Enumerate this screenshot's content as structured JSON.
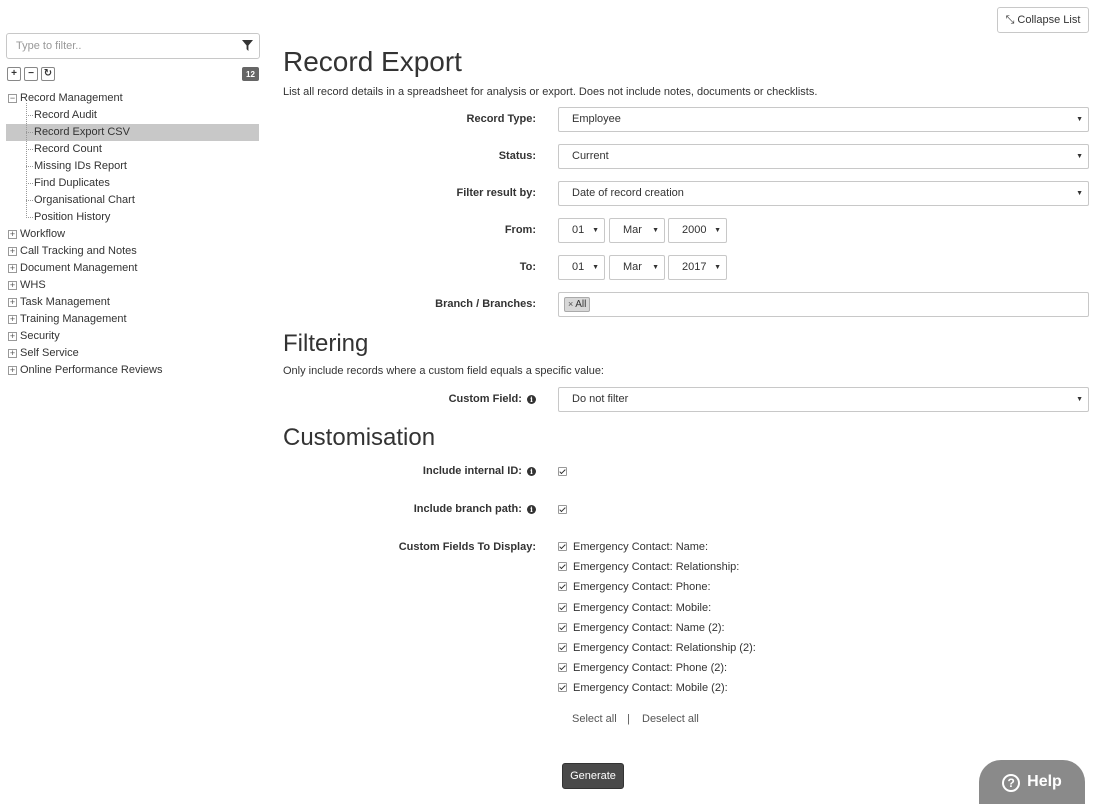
{
  "header": {
    "collapse_label": "Collapse List"
  },
  "sidebar": {
    "filter_placeholder": "Type to filter..",
    "tools": {
      "expand": "+",
      "collapse": "−",
      "refresh": "↻"
    },
    "count": "12",
    "tree": [
      {
        "label": "Record Management",
        "expanded": true,
        "children": [
          {
            "label": "Record Audit"
          },
          {
            "label": "Record Export CSV",
            "selected": true
          },
          {
            "label": "Record Count"
          },
          {
            "label": "Missing IDs Report"
          },
          {
            "label": "Find Duplicates"
          },
          {
            "label": "Organisational Chart"
          },
          {
            "label": "Position History"
          }
        ]
      },
      {
        "label": "Workflow"
      },
      {
        "label": "Call Tracking and Notes"
      },
      {
        "label": "Document Management"
      },
      {
        "label": "WHS"
      },
      {
        "label": "Task Management"
      },
      {
        "label": "Training Management"
      },
      {
        "label": "Security"
      },
      {
        "label": "Self Service"
      },
      {
        "label": "Online Performance Reviews"
      }
    ]
  },
  "main": {
    "title": "Record Export",
    "description": "List all record details in a spreadsheet for analysis or export. Does not include notes, documents or checklists.",
    "fields": {
      "record_type": {
        "label": "Record Type:",
        "value": "Employee"
      },
      "status": {
        "label": "Status:",
        "value": "Current"
      },
      "filter_by": {
        "label": "Filter result by:",
        "value": "Date of record creation"
      },
      "from": {
        "label": "From:",
        "day": "01",
        "month": "Mar",
        "year": "2000"
      },
      "to": {
        "label": "To:",
        "day": "01",
        "month": "Mar",
        "year": "2017"
      },
      "branches": {
        "label": "Branch / Branches:",
        "tag": "All",
        "tag_remove": "×"
      }
    },
    "filtering": {
      "title": "Filtering",
      "description": "Only include records where a custom field equals a specific value:",
      "custom_field": {
        "label": "Custom Field:",
        "value": "Do not filter"
      }
    },
    "customisation": {
      "title": "Customisation",
      "include_internal_id": {
        "label": "Include internal ID:",
        "checked": true
      },
      "include_branch_path": {
        "label": "Include branch path:",
        "checked": true
      },
      "custom_fields_label": "Custom Fields To Display:",
      "custom_fields": [
        "Emergency Contact: Name:",
        "Emergency Contact: Relationship:",
        "Emergency Contact: Phone:",
        "Emergency Contact: Mobile:",
        "Emergency Contact: Name (2):",
        "Emergency Contact: Relationship (2):",
        "Emergency Contact: Phone (2):",
        "Emergency Contact: Mobile (2):"
      ],
      "select_all": "Select all",
      "separator": "|",
      "deselect_all": "Deselect all"
    },
    "generate_label": "Generate"
  },
  "help": {
    "label": "Help",
    "icon": "?"
  }
}
